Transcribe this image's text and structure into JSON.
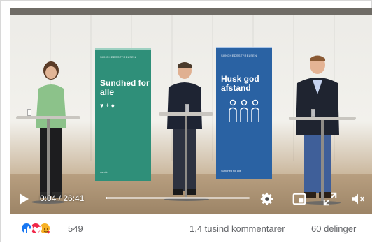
{
  "video": {
    "banners": [
      {
        "header": "SUNDHEDSSTYRELSEN",
        "headline": "Sundhed for alle",
        "symbols": "♥ + ●",
        "footer": "sst.dk",
        "color": "#2f8f79"
      },
      {
        "header": "SUNDHEDSSTYRELSEN",
        "headline": "Husk god afstand",
        "footer": "Sundhed for alle",
        "color": "#2a62a3"
      }
    ]
  },
  "player": {
    "time_current": "0:04",
    "time_total": "26:41",
    "time_display": "0:04 / 26:41",
    "progress_fraction": 0.0025,
    "icons": [
      "play-icon",
      "settings-gear-icon",
      "picture-in-picture-icon",
      "fullscreen-icon",
      "volume-muted-icon"
    ]
  },
  "engagement": {
    "reactions": [
      "like",
      "love",
      "care"
    ],
    "reaction_count": "549",
    "comments": "1,4 tusind kommentarer",
    "shares": "60 delinger"
  },
  "colors": {
    "like": "#1877f2",
    "love": "#f02849",
    "care": "#f7b125",
    "meta_text": "#65676b"
  }
}
